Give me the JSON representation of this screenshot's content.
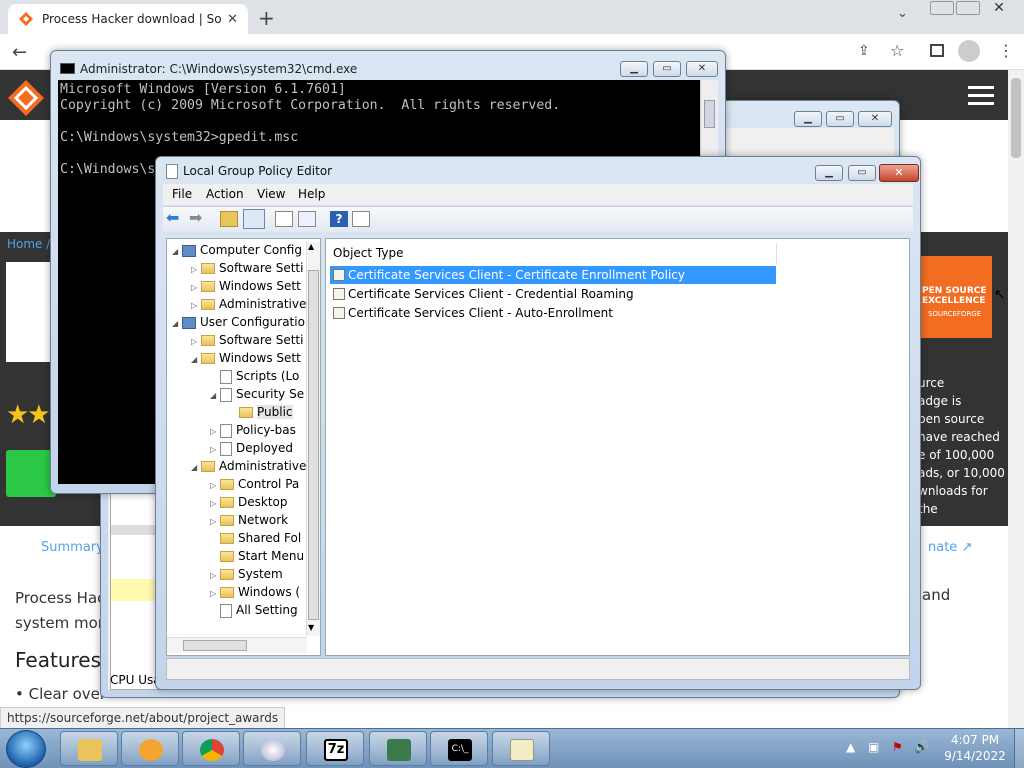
{
  "browser": {
    "tab_title": "Process Hacker download | Sourc",
    "new_tab": "+",
    "status_url": "https://sourceforge.net/about/project_awards"
  },
  "sf_page": {
    "breadcrumb": "Home / ",
    "badge_line1": "PEN SOURCE",
    "badge_line2": "EXCELLENCE",
    "badge_sf": "SOURCEFORGE",
    "side_text": [
      "urce",
      "adge is",
      "pen source",
      " have reached",
      "e of 100,000",
      "ads, or 10,000",
      "wnloads for the"
    ],
    "summary_tab": "Summary",
    "donate_tab": "nate",
    "desc_line1": "Process Hac",
    "desc_line2": "system mon",
    "desc_right": "and",
    "features_heading": "Features",
    "features_first": "• Clear over",
    "stars": "★★"
  },
  "cmd": {
    "title": "Administrator: C:\\Windows\\system32\\cmd.exe",
    "lines": [
      "Microsoft Windows [Version 6.1.7601]",
      "Copyright (c) 2009 Microsoft Corporation.  All rights reserved.",
      "",
      "C:\\Windows\\system32>gpedit.msc",
      "",
      "C:\\Windows\\s"
    ]
  },
  "midwin": {
    "cpu_label": "CPU Usa"
  },
  "gpe": {
    "title": "Local Group Policy Editor",
    "menu": [
      "File",
      "Action",
      "View",
      "Help"
    ],
    "tree": [
      {
        "label": "Computer Config",
        "indent": 0,
        "exp": "◢",
        "icon": "pc"
      },
      {
        "label": "Software Setti",
        "indent": 1,
        "exp": "▷",
        "icon": "folder"
      },
      {
        "label": "Windows Sett",
        "indent": 1,
        "exp": "▷",
        "icon": "folder"
      },
      {
        "label": "Administrative",
        "indent": 1,
        "exp": "▷",
        "icon": "folder"
      },
      {
        "label": "User Configuratio",
        "indent": 0,
        "exp": "◢",
        "icon": "pc"
      },
      {
        "label": "Software Setti",
        "indent": 1,
        "exp": "▷",
        "icon": "folder"
      },
      {
        "label": "Windows Sett",
        "indent": 1,
        "exp": "◢",
        "icon": "folder"
      },
      {
        "label": "Scripts (Lo",
        "indent": 2,
        "exp": "",
        "icon": "doc"
      },
      {
        "label": "Security Se",
        "indent": 2,
        "exp": "◢",
        "icon": "doc"
      },
      {
        "label": "Public",
        "indent": 3,
        "exp": "",
        "icon": "folder"
      },
      {
        "label": "Policy-bas",
        "indent": 2,
        "exp": "▷",
        "icon": "doc"
      },
      {
        "label": "Deployed",
        "indent": 2,
        "exp": "▷",
        "icon": "doc"
      },
      {
        "label": "Administrative",
        "indent": 1,
        "exp": "◢",
        "icon": "folder"
      },
      {
        "label": "Control Pa",
        "indent": 2,
        "exp": "▷",
        "icon": "folder"
      },
      {
        "label": "Desktop",
        "indent": 2,
        "exp": "▷",
        "icon": "folder"
      },
      {
        "label": "Network",
        "indent": 2,
        "exp": "▷",
        "icon": "folder"
      },
      {
        "label": "Shared Fol",
        "indent": 2,
        "exp": "",
        "icon": "folder"
      },
      {
        "label": "Start Menu",
        "indent": 2,
        "exp": "",
        "icon": "folder"
      },
      {
        "label": "System",
        "indent": 2,
        "exp": "▷",
        "icon": "folder"
      },
      {
        "label": "Windows (",
        "indent": 2,
        "exp": "▷",
        "icon": "folder"
      },
      {
        "label": "All Setting",
        "indent": 2,
        "exp": "",
        "icon": "doc"
      }
    ],
    "list_header": "Object Type",
    "list_rows": [
      "Certificate Services Client - Certificate Enrollment Policy",
      "Certificate Services Client - Credential Roaming",
      "Certificate Services Client - Auto-Enrollment"
    ]
  },
  "taskbar": {
    "time": "4:07 PM",
    "date": "9/14/2022",
    "sevenzip_label": "7z",
    "cmd_label": "C:\\_"
  }
}
